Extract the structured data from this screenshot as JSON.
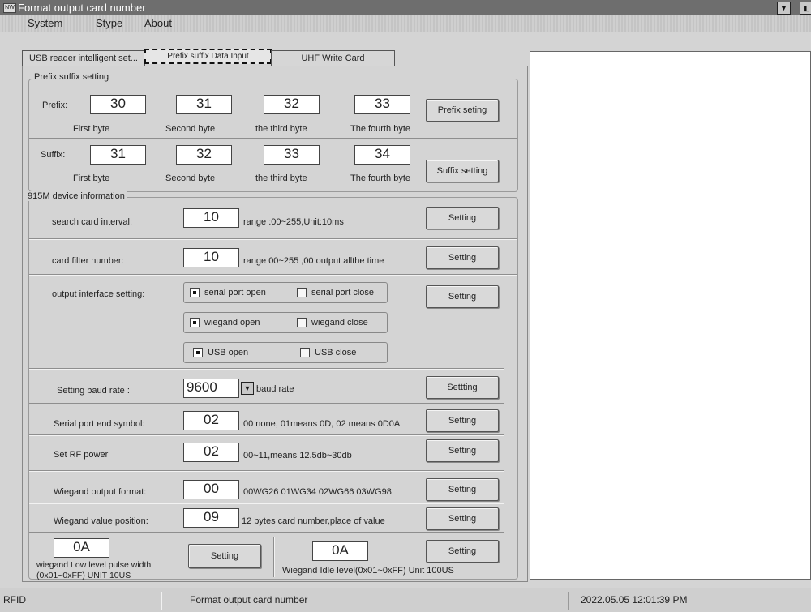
{
  "window": {
    "title": "Format output  card number",
    "icon": "app-icon"
  },
  "menu": [
    "System",
    "Stype",
    "About"
  ],
  "tabs": [
    "USB reader intelligent set...",
    "Prefix suffix Data Input",
    "UHF Write Card"
  ],
  "prefix_suffix": {
    "caption": "Prefix suffix setting",
    "prefix_label": "Prefix:",
    "prefix_values": [
      "30",
      "31",
      "32",
      "33"
    ],
    "suffix_label": "Suffix:",
    "suffix_values": [
      "31",
      "32",
      "33",
      "34"
    ],
    "byte_labels": [
      "First byte",
      "Second byte",
      "the third byte",
      "The fourth byte"
    ],
    "prefix_button": "Prefix seting",
    "suffix_button": "Suffix setting"
  },
  "device": {
    "caption": "915M device information",
    "search_interval": {
      "label": "search card interval:",
      "value": "10",
      "hint": "range :00~255,Unit:10ms",
      "button": "Setting"
    },
    "filter_number": {
      "label": "card filter number:",
      "value": "10",
      "hint": "range  00~255 ,00 output allthe time",
      "button": "Setting"
    },
    "output_interface": {
      "label": "output interface setting:",
      "serial_open": "serial port open",
      "serial_close": "serial port close",
      "wiegand_open": "wiegand open",
      "wiegand_close": "wiegand close",
      "usb_open": "USB open",
      "usb_close": "USB close",
      "button": "Setting"
    },
    "baud": {
      "label": "Setting baud rate :",
      "value": "9600",
      "unit": "baud rate",
      "button": "Settting"
    },
    "end_symbol": {
      "label": "Serial port end symbol:",
      "value": "02",
      "hint": "00 none, 01means 0D,  02 means 0D0A",
      "button": "Setting"
    },
    "rf_power": {
      "label": "Set RF power",
      "value": "02",
      "hint": "00~11,means 12.5db~30db",
      "button": "Setting"
    },
    "wiegand_format": {
      "label": "Wiegand output format:",
      "value": "00",
      "hint": "00WG26 01WG34 02WG66 03WG98",
      "button": "Setting"
    },
    "wiegand_position": {
      "label": "Wiegand value position:",
      "value": "09",
      "hint": "12 bytes card number,place of value",
      "button": "Setting"
    },
    "low_pulse": {
      "value": "0A",
      "label_line1": "wiegand Low level pulse width",
      "label_line2": "(0x01~0xFF) UNIT 10US",
      "button": "Setting"
    },
    "idle_level": {
      "value": "0A",
      "label": "Wiegand Idle level(0x01~0xFF) Unit 100US",
      "button": "Setting"
    }
  },
  "status": {
    "left": "RFID",
    "middle": "Format output  card number",
    "datetime": "2022.05.05  12:01:39 PM"
  }
}
